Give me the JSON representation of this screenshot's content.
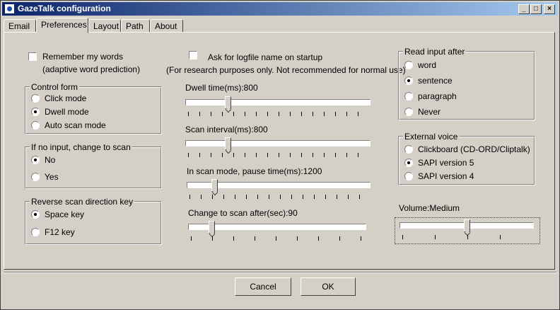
{
  "window": {
    "title": "GazeTalk configuration",
    "min_symbol": "_",
    "max_symbol": "□",
    "close_symbol": "×"
  },
  "tabs": [
    {
      "label": "Email"
    },
    {
      "label": "Preferences",
      "active": true
    },
    {
      "label": "Layout"
    },
    {
      "label": "Path"
    },
    {
      "label": "About"
    }
  ],
  "preferences": {
    "remember_words": {
      "label": "Remember my words",
      "note": "(adaptive word prediction)",
      "checked": false
    },
    "logfile": {
      "label": "Ask for logfile name on startup",
      "note": "(For research purposes only. Not recommended for normal use)",
      "checked": false
    },
    "control_form": {
      "title": "Control form",
      "options": [
        "Click mode",
        "Dwell mode",
        "Auto scan mode"
      ],
      "selected": "Dwell mode"
    },
    "no_input": {
      "title": "If no input, change to scan",
      "options": [
        "No",
        "Yes"
      ],
      "selected": "No"
    },
    "reverse_key": {
      "title": "Reverse scan direction key",
      "options": [
        "Space key",
        "F12 key"
      ],
      "selected": "Space key"
    },
    "sliders": {
      "dwell_time": {
        "label": "Dwell time(ms):800",
        "value": 0.22
      },
      "scan_interval": {
        "label": "Scan interval(ms):800",
        "value": 0.22
      },
      "pause_time": {
        "label": "In scan mode, pause time(ms):1200",
        "value": 0.14
      },
      "change_scan": {
        "label": "Change to scan after(sec):90",
        "value": 0.12
      }
    },
    "read_input": {
      "title": "Read input after",
      "options": [
        "word",
        "sentence",
        "paragraph",
        "Never"
      ],
      "selected": "sentence"
    },
    "external_voice": {
      "title": "External voice",
      "options": [
        "Clickboard (CD-ORD/Cliptalk)",
        "SAPI version 5",
        "SAPI version 4"
      ],
      "selected": "SAPI version 5"
    },
    "volume": {
      "label": "Volume:Medium",
      "value": 0.5
    }
  },
  "buttons": {
    "cancel": "Cancel",
    "ok": "OK"
  },
  "colors": {
    "face": "#d4d0c8",
    "title_start": "#0a246a",
    "title_end": "#a6caf0"
  }
}
